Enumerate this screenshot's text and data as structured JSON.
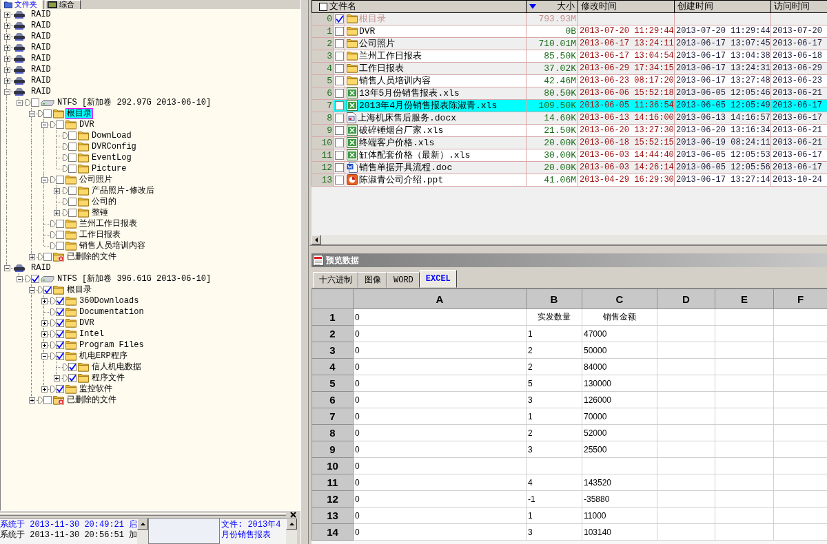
{
  "left_panel": {
    "tabs": [
      {
        "label": "文件夹",
        "selected": true
      },
      {
        "label": "综合",
        "selected": false
      }
    ]
  },
  "tree": [
    {
      "kind": "raid",
      "label": "RAID",
      "expanded": false,
      "selected": false
    },
    {
      "kind": "raid",
      "label": "RAID",
      "expanded": false,
      "selected": false
    },
    {
      "kind": "raid",
      "label": "RAID",
      "expanded": false,
      "selected": false
    },
    {
      "kind": "raid",
      "label": "RAID",
      "expanded": false,
      "selected": false
    },
    {
      "kind": "raid",
      "label": "RAID",
      "expanded": false,
      "selected": false
    },
    {
      "kind": "raid",
      "label": "RAID",
      "expanded": false,
      "selected": false
    },
    {
      "kind": "raid",
      "label": "RAID",
      "expanded": false,
      "selected": false
    },
    {
      "kind": "raid",
      "label": "RAID",
      "expanded": true,
      "selected": false,
      "children": [
        {
          "kind": "volume",
          "label": "NTFS [新加卷 292.97G 2013-06-10]",
          "expanded": true,
          "checked": false,
          "selected": false,
          "children": [
            {
              "kind": "folder",
              "label": "根目录",
              "expanded": true,
              "checked": false,
              "selected": true,
              "children": [
                {
                  "kind": "folder",
                  "label": "DVR",
                  "expanded": true,
                  "checked": false,
                  "selected": false,
                  "children": [
                    {
                      "kind": "folder",
                      "label": "DownLoad",
                      "checked": false,
                      "selected": false
                    },
                    {
                      "kind": "folder",
                      "label": "DVRConfig",
                      "checked": false,
                      "selected": false
                    },
                    {
                      "kind": "folder",
                      "label": "EventLog",
                      "checked": false,
                      "selected": false
                    },
                    {
                      "kind": "folder",
                      "label": "Picture",
                      "checked": false,
                      "selected": false
                    }
                  ]
                },
                {
                  "kind": "folder",
                  "label": "公司照片",
                  "expanded": true,
                  "checked": false,
                  "selected": false,
                  "children": [
                    {
                      "kind": "folder",
                      "label": "产品照片-修改后",
                      "expanded": false,
                      "checked": false,
                      "selected": false
                    },
                    {
                      "kind": "folder",
                      "label": "公司的",
                      "checked": false,
                      "selected": false
                    },
                    {
                      "kind": "folder",
                      "label": "整锤",
                      "expanded": false,
                      "checked": false,
                      "selected": false
                    }
                  ]
                },
                {
                  "kind": "folder",
                  "label": "兰州工作日报表",
                  "checked": false,
                  "selected": false
                },
                {
                  "kind": "folder",
                  "label": "工作日报表",
                  "checked": false,
                  "selected": false
                },
                {
                  "kind": "folder",
                  "label": "销售人员培训内容",
                  "checked": false,
                  "selected": false
                }
              ]
            },
            {
              "kind": "deleted",
              "label": "已删除的文件",
              "expanded": false,
              "checked": false,
              "selected": false
            }
          ]
        }
      ]
    },
    {
      "kind": "raid",
      "label": "RAID",
      "expanded": true,
      "selected": false,
      "children": [
        {
          "kind": "volume",
          "label": "NTFS [新加卷 396.61G 2013-06-10]",
          "expanded": true,
          "checked": true,
          "selected": false,
          "children": [
            {
              "kind": "folder",
              "label": "根目录",
              "expanded": true,
              "checked": true,
              "selected": false,
              "children": [
                {
                  "kind": "folder",
                  "label": "360Downloads",
                  "expanded": false,
                  "checked": true,
                  "selected": false
                },
                {
                  "kind": "folder",
                  "label": "Documentation",
                  "checked": true,
                  "selected": false
                },
                {
                  "kind": "folder",
                  "label": "DVR",
                  "expanded": false,
                  "checked": true,
                  "selected": false
                },
                {
                  "kind": "folder",
                  "label": "Intel",
                  "expanded": false,
                  "checked": true,
                  "selected": false
                },
                {
                  "kind": "folder",
                  "label": "Program Files",
                  "expanded": false,
                  "checked": true,
                  "selected": false
                },
                {
                  "kind": "folder",
                  "label": "机电ERP程序",
                  "expanded": true,
                  "checked": true,
                  "selected": false,
                  "children": [
                    {
                      "kind": "folder",
                      "label": "信人机电数据",
                      "checked": true,
                      "selected": false
                    },
                    {
                      "kind": "folder",
                      "label": "程序文件",
                      "expanded": false,
                      "checked": true,
                      "selected": false
                    }
                  ]
                },
                {
                  "kind": "folder",
                  "label": "监控软件",
                  "expanded": false,
                  "checked": true,
                  "selected": false
                }
              ]
            },
            {
              "kind": "deleted",
              "label": "已删除的文件",
              "expanded": false,
              "checked": false,
              "selected": false
            }
          ]
        }
      ]
    }
  ],
  "log": {
    "lines": [
      {
        "text": "系统于 2013-11-30 20:49:21 启",
        "color": "#0000ff"
      },
      {
        "text": "系统于 2013-11-30 20:56:51 加",
        "color": "#000000"
      }
    ],
    "details": [
      "文件: 2013年4",
      "月份销售报表"
    ]
  },
  "file_list": {
    "all_checked": false,
    "columns": [
      {
        "label": "文件名",
        "sorted": false
      },
      {
        "label": "大小",
        "sorted": true
      },
      {
        "label": "修改时间",
        "sorted": false
      },
      {
        "label": "创建时间",
        "sorted": false
      },
      {
        "label": "访问时间",
        "sorted": false
      }
    ],
    "rows": [
      {
        "index": "0",
        "checked": true,
        "selected": false,
        "dimmed": true,
        "kind": "folder",
        "name": "根目录",
        "size": "793.93M"
      },
      {
        "index": "1",
        "checked": false,
        "selected": false,
        "dimmed": false,
        "kind": "folder",
        "name": "DVR",
        "size": "0B",
        "modified": "2013-07-20 11:29:44",
        "created": "2013-07-20 11:29:44",
        "accessed": "2013-07-20"
      },
      {
        "index": "2",
        "checked": false,
        "selected": false,
        "dimmed": false,
        "kind": "folder",
        "name": "公司照片",
        "size": "710.01M",
        "modified": "2013-06-17 13:24:11",
        "created": "2013-06-17 13:07:45",
        "accessed": "2013-06-17"
      },
      {
        "index": "3",
        "checked": false,
        "selected": false,
        "dimmed": false,
        "kind": "folder",
        "name": "兰州工作日报表",
        "size": "85.50K",
        "modified": "2013-06-17 13:04:54",
        "created": "2013-06-17 13:04:38",
        "accessed": "2013-06-18"
      },
      {
        "index": "4",
        "checked": false,
        "selected": false,
        "dimmed": false,
        "kind": "folder",
        "name": "工作日报表",
        "size": "37.02K",
        "modified": "2013-06-29 17:34:15",
        "created": "2013-06-17 13:24:31",
        "accessed": "2013-06-29"
      },
      {
        "index": "5",
        "checked": false,
        "selected": false,
        "dimmed": false,
        "kind": "folder",
        "name": "销售人员培训内容",
        "size": "42.46M",
        "modified": "2013-06-23 08:17:20",
        "created": "2013-06-17 13:27:48",
        "accessed": "2013-06-23"
      },
      {
        "index": "6",
        "checked": false,
        "selected": false,
        "dimmed": false,
        "kind": "excel",
        "name": "13年5月份销售报表.xls",
        "size": "80.50K",
        "modified": "2013-06-06 15:52:18",
        "created": "2013-06-05 12:05:46",
        "accessed": "2013-06-21"
      },
      {
        "index": "7",
        "checked": false,
        "selected": true,
        "dimmed": false,
        "kind": "excel",
        "name": "2013年4月份销售报表陈淑青.xls",
        "size": "109.50K",
        "modified": "2013-06-05 11:36:54",
        "created": "2013-06-05 12:05:49",
        "accessed": "2013-06-17"
      },
      {
        "index": "8",
        "checked": false,
        "selected": false,
        "dimmed": false,
        "kind": "docx",
        "name": "上海机床售后服务.docx",
        "size": "14.60K",
        "modified": "2013-06-13 14:16:00",
        "created": "2013-06-13 14:16:57",
        "accessed": "2013-06-17"
      },
      {
        "index": "9",
        "checked": false,
        "selected": false,
        "dimmed": false,
        "kind": "excel",
        "name": "破碎锤烟台厂家.xls",
        "size": "21.50K",
        "modified": "2013-06-20 13:27:30",
        "created": "2013-06-20 13:16:34",
        "accessed": "2013-06-21"
      },
      {
        "index": "10",
        "checked": false,
        "selected": false,
        "dimmed": false,
        "kind": "excel",
        "name": "终端客户价格.xls",
        "size": "20.00K",
        "modified": "2013-06-18 15:52:15",
        "created": "2013-06-19 08:24:11",
        "accessed": "2013-06-21"
      },
      {
        "index": "11",
        "checked": false,
        "selected": false,
        "dimmed": false,
        "kind": "excel",
        "name": "缸体配套价格（最新）.xls",
        "size": "30.00K",
        "modified": "2013-06-03 14:44:40",
        "created": "2013-06-05 12:05:53",
        "accessed": "2013-06-17"
      },
      {
        "index": "12",
        "checked": false,
        "selected": false,
        "dimmed": false,
        "kind": "doc",
        "name": "销售单据开具流程.doc",
        "size": "20.00K",
        "modified": "2013-06-03 14:26:14",
        "created": "2013-06-05 12:05:56",
        "accessed": "2013-06-17"
      },
      {
        "index": "13",
        "checked": false,
        "selected": false,
        "dimmed": false,
        "kind": "ppt",
        "name": "陈淑青公司介绍.ppt",
        "size": "41.06M",
        "modified": "2013-04-29 16:29:30",
        "created": "2013-06-17 13:27:14",
        "accessed": "2013-10-24"
      }
    ]
  },
  "preview": {
    "title": "预览数据",
    "tabs": [
      {
        "label": "十六进制",
        "selected": false
      },
      {
        "label": "图像",
        "selected": false
      },
      {
        "label": "WORD",
        "selected": false
      },
      {
        "label": "EXCEL",
        "selected": true
      }
    ],
    "sheet": {
      "columns": [
        "A",
        "B",
        "C",
        "D",
        "E",
        "F"
      ],
      "rows": [
        {
          "label": "1",
          "kind": "title",
          "cells": [
            "0",
            "实发数量",
            "销售金额"
          ]
        },
        {
          "label": "2",
          "kind": "data",
          "cells": [
            "0",
            "1",
            "47000"
          ]
        },
        {
          "label": "3",
          "kind": "data",
          "cells": [
            "0",
            "2",
            "50000"
          ]
        },
        {
          "label": "4",
          "kind": "data",
          "cells": [
            "0",
            "2",
            "84000"
          ]
        },
        {
          "label": "5",
          "kind": "data",
          "cells": [
            "0",
            "5",
            "130000"
          ]
        },
        {
          "label": "6",
          "kind": "data",
          "cells": [
            "0",
            "3",
            "126000"
          ]
        },
        {
          "label": "7",
          "kind": "data",
          "cells": [
            "0",
            "1",
            "70000"
          ]
        },
        {
          "label": "8",
          "kind": "data",
          "cells": [
            "0",
            "2",
            "52000"
          ]
        },
        {
          "label": "9",
          "kind": "data",
          "cells": [
            "0",
            "3",
            "25500"
          ]
        },
        {
          "label": "10",
          "kind": "data",
          "cells": [
            "0"
          ]
        },
        {
          "label": "11",
          "kind": "data",
          "cells": [
            "0",
            "4",
            "143520"
          ]
        },
        {
          "label": "12",
          "kind": "data",
          "cells": [
            "0",
            "-1",
            "-35880"
          ]
        },
        {
          "label": "13",
          "kind": "data",
          "cells": [
            "0",
            "1",
            "11000"
          ]
        },
        {
          "label": "14",
          "kind": "data",
          "cells": [
            "0",
            "3",
            "103140"
          ]
        }
      ]
    }
  }
}
